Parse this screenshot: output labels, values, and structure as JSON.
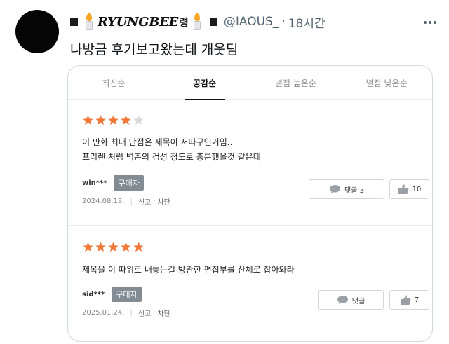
{
  "tweet": {
    "display_name": "RYUNGBEE",
    "display_name_suffix": "령",
    "handle": "@IAOUS_",
    "separator": "·",
    "time": "18시간",
    "text": "나방금 후기보고왔는데 개웃딤"
  },
  "review_tabs": [
    {
      "label": "최신순",
      "active": false
    },
    {
      "label": "공감순",
      "active": true
    },
    {
      "label": "별점 높은순",
      "active": false
    },
    {
      "label": "별점 낮은순",
      "active": false
    }
  ],
  "reviews": [
    {
      "rating": 4,
      "rating_max": 5,
      "lines": [
        "이 만화 최대 단점은 제목이 저따구인거임..",
        "프리렌 처럼 벽촌의 검성 정도로 충분했을것 같은데"
      ],
      "user": "win***",
      "badge": "구매자",
      "date": "2024.08.13.",
      "report": "신고",
      "dot": "·",
      "block": "차단",
      "comment_label": "댓글 3",
      "likes": "10"
    },
    {
      "rating": 5,
      "rating_max": 5,
      "lines": [
        "제목을 이 따위로 내놓는걸 방관한 편집부를 산체로 잡아와라"
      ],
      "user": "sid***",
      "badge": "구매자",
      "date": "2025.01.24.",
      "report": "신고",
      "dot": "·",
      "block": "차단",
      "comment_label": "댓글",
      "likes": "7"
    }
  ],
  "colors": {
    "star_filled": "#f0793a",
    "star_empty": "#d9d9d9",
    "badge_bg": "#848c93",
    "meta_text": "#536471"
  },
  "icons": [
    "candle-icon",
    "more-icon",
    "star-icon",
    "comment-icon",
    "thumbs-up-icon"
  ]
}
